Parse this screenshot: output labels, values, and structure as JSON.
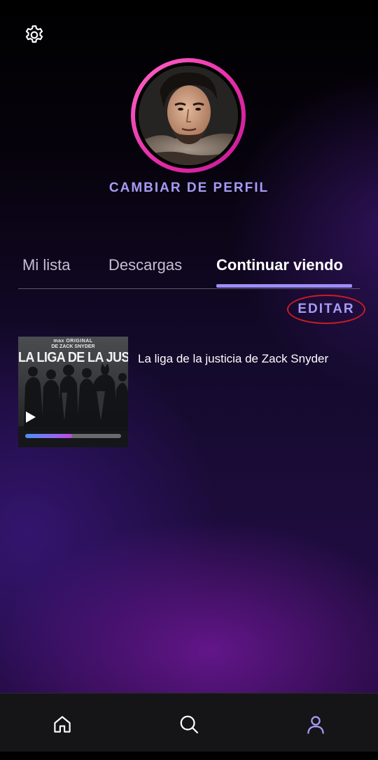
{
  "header": {
    "settings_icon": "gear-icon"
  },
  "profile": {
    "ring_color": "#e62ca8",
    "switch_label": "CAMBIAR DE PERFIL"
  },
  "tabs": [
    {
      "label": "Mi lista",
      "active": false
    },
    {
      "label": "Descargas",
      "active": false
    },
    {
      "label": "Continuar viendo",
      "active": true
    }
  ],
  "edit": {
    "label": "EDITAR"
  },
  "continue_watching": [
    {
      "title": "La liga de la justicia de Zack Snyder",
      "poster": {
        "brand": "max ORIGINAL",
        "byline": "DE ZACK SNYDER",
        "title": "LA LIGA DE LA JUSTICIA"
      },
      "progress": 0.49,
      "play_icon": "play-icon"
    }
  ],
  "bottom_nav": [
    {
      "icon": "home-icon",
      "active": false
    },
    {
      "icon": "search-icon",
      "active": false
    },
    {
      "icon": "profile-icon",
      "active": true
    }
  ],
  "colors": {
    "accent": "#a79bf5",
    "tab_underline": "#9d8ef5",
    "edit_highlight": "#c81d26",
    "nav_active": "#a79bf5"
  }
}
